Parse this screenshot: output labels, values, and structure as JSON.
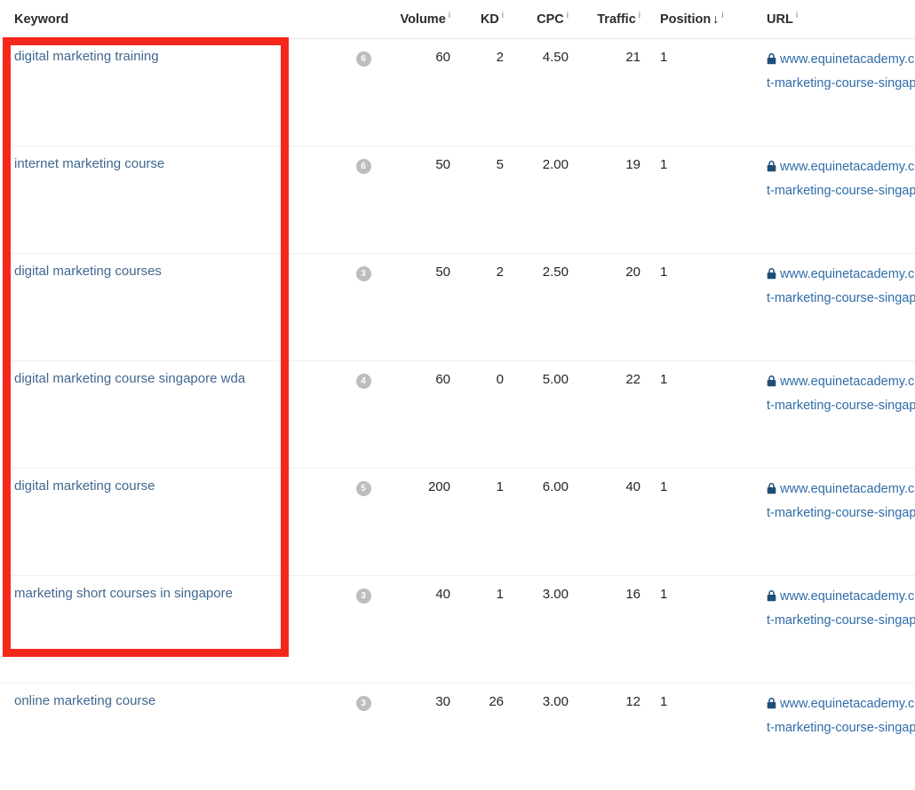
{
  "table": {
    "columns": [
      {
        "key": "keyword",
        "label": "Keyword",
        "info": false,
        "sorted": false
      },
      {
        "key": "badge",
        "label": "",
        "info": false,
        "sorted": false
      },
      {
        "key": "volume",
        "label": "Volume",
        "info": true,
        "sorted": false
      },
      {
        "key": "kd",
        "label": "KD",
        "info": true,
        "sorted": false
      },
      {
        "key": "cpc",
        "label": "CPC",
        "info": true,
        "sorted": false
      },
      {
        "key": "traffic",
        "label": "Traffic",
        "info": true,
        "sorted": false
      },
      {
        "key": "position",
        "label": "Position",
        "info": true,
        "sorted": true
      },
      {
        "key": "url",
        "label": "URL",
        "info": true,
        "sorted": false
      }
    ],
    "info_marker": "i",
    "sort_marker": "↓",
    "rows": [
      {
        "keyword": "digital marketing training",
        "badge": "6",
        "volume": "60",
        "kd": "2",
        "cpc": "4.50",
        "traffic": "21",
        "position": "1",
        "url": "www.equinetacademy.com/internet-marketing-course-singapore/",
        "url_secure": true
      },
      {
        "keyword": "internet marketing course",
        "badge": "6",
        "volume": "50",
        "kd": "5",
        "cpc": "2.00",
        "traffic": "19",
        "position": "1",
        "url": "www.equinetacademy.com/internet-marketing-course-singapore/",
        "url_secure": true
      },
      {
        "keyword": "digital marketing courses",
        "badge": "3",
        "volume": "50",
        "kd": "2",
        "cpc": "2.50",
        "traffic": "20",
        "position": "1",
        "url": "www.equinetacademy.com/internet-marketing-course-singapore/",
        "url_secure": true
      },
      {
        "keyword": "digital marketing course singapore wda",
        "badge": "4",
        "volume": "60",
        "kd": "0",
        "cpc": "5.00",
        "traffic": "22",
        "position": "1",
        "url": "www.equinetacademy.com/internet-marketing-course-singapore/",
        "url_secure": true
      },
      {
        "keyword": "digital marketing course",
        "badge": "5",
        "volume": "200",
        "kd": "1",
        "cpc": "6.00",
        "traffic": "40",
        "position": "1",
        "url": "www.equinetacademy.com/internet-marketing-course-singapore/",
        "url_secure": true
      },
      {
        "keyword": "marketing short courses in singapore",
        "badge": "3",
        "volume": "40",
        "kd": "1",
        "cpc": "3.00",
        "traffic": "16",
        "position": "1",
        "url": "www.equinetacademy.com/internet-marketing-course-singapore/",
        "url_secure": true
      },
      {
        "keyword": "online marketing course",
        "badge": "3",
        "volume": "30",
        "kd": "26",
        "cpc": "3.00",
        "traffic": "12",
        "position": "1",
        "url": "www.equinetacademy.com/internet-marketing-course-singapore/",
        "url_secure": true
      }
    ]
  },
  "annotation": {
    "type": "highlight-rectangle",
    "color": "#f4271b",
    "target": "keyword-column"
  },
  "colors": {
    "accent_red": "#f4271b",
    "link_blue": "#41688f",
    "url_blue": "#2f6ca8",
    "badge_gray": "#bdbdbd",
    "header_text": "#2b2b2b",
    "row_divider": "#eceff1"
  }
}
